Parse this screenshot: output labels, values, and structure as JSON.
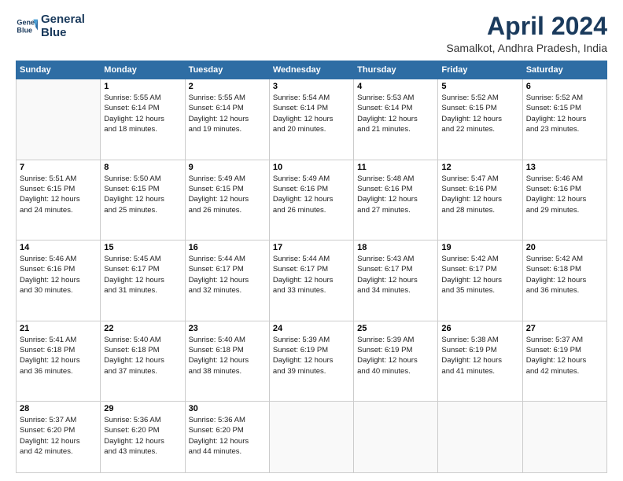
{
  "header": {
    "logo_line1": "General",
    "logo_line2": "Blue",
    "title": "April 2024",
    "location": "Samalkot, Andhra Pradesh, India"
  },
  "weekdays": [
    "Sunday",
    "Monday",
    "Tuesday",
    "Wednesday",
    "Thursday",
    "Friday",
    "Saturday"
  ],
  "weeks": [
    [
      {
        "day": "",
        "info": ""
      },
      {
        "day": "1",
        "info": "Sunrise: 5:55 AM\nSunset: 6:14 PM\nDaylight: 12 hours\nand 18 minutes."
      },
      {
        "day": "2",
        "info": "Sunrise: 5:55 AM\nSunset: 6:14 PM\nDaylight: 12 hours\nand 19 minutes."
      },
      {
        "day": "3",
        "info": "Sunrise: 5:54 AM\nSunset: 6:14 PM\nDaylight: 12 hours\nand 20 minutes."
      },
      {
        "day": "4",
        "info": "Sunrise: 5:53 AM\nSunset: 6:14 PM\nDaylight: 12 hours\nand 21 minutes."
      },
      {
        "day": "5",
        "info": "Sunrise: 5:52 AM\nSunset: 6:15 PM\nDaylight: 12 hours\nand 22 minutes."
      },
      {
        "day": "6",
        "info": "Sunrise: 5:52 AM\nSunset: 6:15 PM\nDaylight: 12 hours\nand 23 minutes."
      }
    ],
    [
      {
        "day": "7",
        "info": "Sunrise: 5:51 AM\nSunset: 6:15 PM\nDaylight: 12 hours\nand 24 minutes."
      },
      {
        "day": "8",
        "info": "Sunrise: 5:50 AM\nSunset: 6:15 PM\nDaylight: 12 hours\nand 25 minutes."
      },
      {
        "day": "9",
        "info": "Sunrise: 5:49 AM\nSunset: 6:15 PM\nDaylight: 12 hours\nand 26 minutes."
      },
      {
        "day": "10",
        "info": "Sunrise: 5:49 AM\nSunset: 6:16 PM\nDaylight: 12 hours\nand 26 minutes."
      },
      {
        "day": "11",
        "info": "Sunrise: 5:48 AM\nSunset: 6:16 PM\nDaylight: 12 hours\nand 27 minutes."
      },
      {
        "day": "12",
        "info": "Sunrise: 5:47 AM\nSunset: 6:16 PM\nDaylight: 12 hours\nand 28 minutes."
      },
      {
        "day": "13",
        "info": "Sunrise: 5:46 AM\nSunset: 6:16 PM\nDaylight: 12 hours\nand 29 minutes."
      }
    ],
    [
      {
        "day": "14",
        "info": "Sunrise: 5:46 AM\nSunset: 6:16 PM\nDaylight: 12 hours\nand 30 minutes."
      },
      {
        "day": "15",
        "info": "Sunrise: 5:45 AM\nSunset: 6:17 PM\nDaylight: 12 hours\nand 31 minutes."
      },
      {
        "day": "16",
        "info": "Sunrise: 5:44 AM\nSunset: 6:17 PM\nDaylight: 12 hours\nand 32 minutes."
      },
      {
        "day": "17",
        "info": "Sunrise: 5:44 AM\nSunset: 6:17 PM\nDaylight: 12 hours\nand 33 minutes."
      },
      {
        "day": "18",
        "info": "Sunrise: 5:43 AM\nSunset: 6:17 PM\nDaylight: 12 hours\nand 34 minutes."
      },
      {
        "day": "19",
        "info": "Sunrise: 5:42 AM\nSunset: 6:17 PM\nDaylight: 12 hours\nand 35 minutes."
      },
      {
        "day": "20",
        "info": "Sunrise: 5:42 AM\nSunset: 6:18 PM\nDaylight: 12 hours\nand 36 minutes."
      }
    ],
    [
      {
        "day": "21",
        "info": "Sunrise: 5:41 AM\nSunset: 6:18 PM\nDaylight: 12 hours\nand 36 minutes."
      },
      {
        "day": "22",
        "info": "Sunrise: 5:40 AM\nSunset: 6:18 PM\nDaylight: 12 hours\nand 37 minutes."
      },
      {
        "day": "23",
        "info": "Sunrise: 5:40 AM\nSunset: 6:18 PM\nDaylight: 12 hours\nand 38 minutes."
      },
      {
        "day": "24",
        "info": "Sunrise: 5:39 AM\nSunset: 6:19 PM\nDaylight: 12 hours\nand 39 minutes."
      },
      {
        "day": "25",
        "info": "Sunrise: 5:39 AM\nSunset: 6:19 PM\nDaylight: 12 hours\nand 40 minutes."
      },
      {
        "day": "26",
        "info": "Sunrise: 5:38 AM\nSunset: 6:19 PM\nDaylight: 12 hours\nand 41 minutes."
      },
      {
        "day": "27",
        "info": "Sunrise: 5:37 AM\nSunset: 6:19 PM\nDaylight: 12 hours\nand 42 minutes."
      }
    ],
    [
      {
        "day": "28",
        "info": "Sunrise: 5:37 AM\nSunset: 6:20 PM\nDaylight: 12 hours\nand 42 minutes."
      },
      {
        "day": "29",
        "info": "Sunrise: 5:36 AM\nSunset: 6:20 PM\nDaylight: 12 hours\nand 43 minutes."
      },
      {
        "day": "30",
        "info": "Sunrise: 5:36 AM\nSunset: 6:20 PM\nDaylight: 12 hours\nand 44 minutes."
      },
      {
        "day": "",
        "info": ""
      },
      {
        "day": "",
        "info": ""
      },
      {
        "day": "",
        "info": ""
      },
      {
        "day": "",
        "info": ""
      }
    ]
  ]
}
